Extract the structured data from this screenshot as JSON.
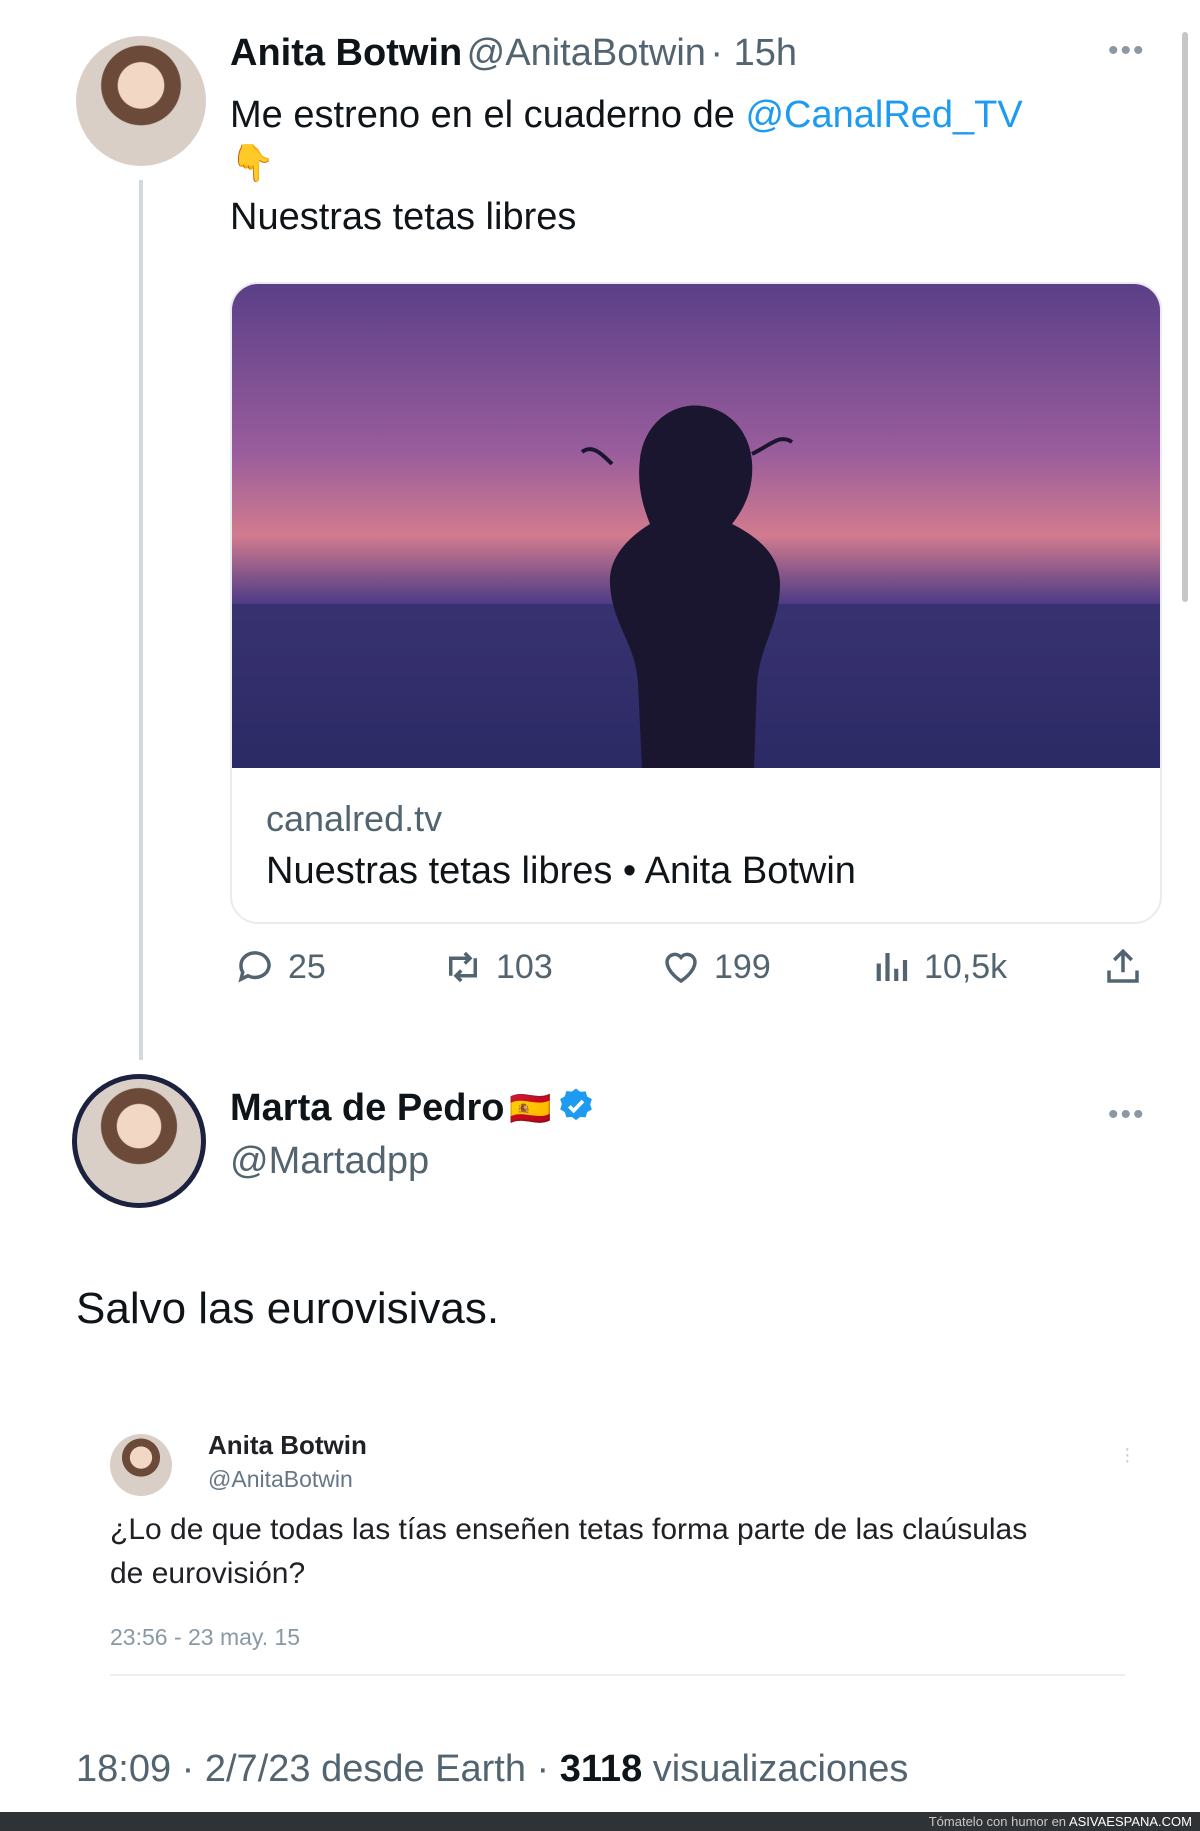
{
  "tweet1": {
    "name": "Anita Botwin",
    "handle": "@AnitaBotwin",
    "time": "· 15h",
    "text_before": "Me estreno en el cuaderno de ",
    "mention": "@CanalRed_TV",
    "emoji": "👇",
    "text_line2": "Nuestras tetas libres",
    "card": {
      "domain": "canalred.tv",
      "title": "Nuestras tetas libres • Anita Botwin"
    },
    "actions": {
      "replies": "25",
      "retweets": "103",
      "likes": "199",
      "views": "10,5k"
    }
  },
  "tweet2": {
    "name": "Marta de Pedro",
    "flag": "🇪🇸",
    "handle": "@Martadpp",
    "text": "Salvo las eurovisivas.",
    "quoted": {
      "name": "Anita Botwin",
      "handle": "@AnitaBotwin",
      "text": "¿Lo de que todas las tías enseñen tetas forma parte de las claúsulas de eurovisión?",
      "timestamp": "23:56 - 23 may. 15"
    },
    "footer": {
      "time": "18:09 · 2/7/23 desde Earth · ",
      "views_count": "3118",
      "views_label": " visualizaciones"
    }
  },
  "watermark": {
    "prefix": "Tómatelo con humor en ",
    "site": "ASIVAESPANA.COM"
  },
  "colors": {
    "accent": "#1d9bf0",
    "secondary_text": "#536471",
    "verified": "#1d9bf0"
  }
}
